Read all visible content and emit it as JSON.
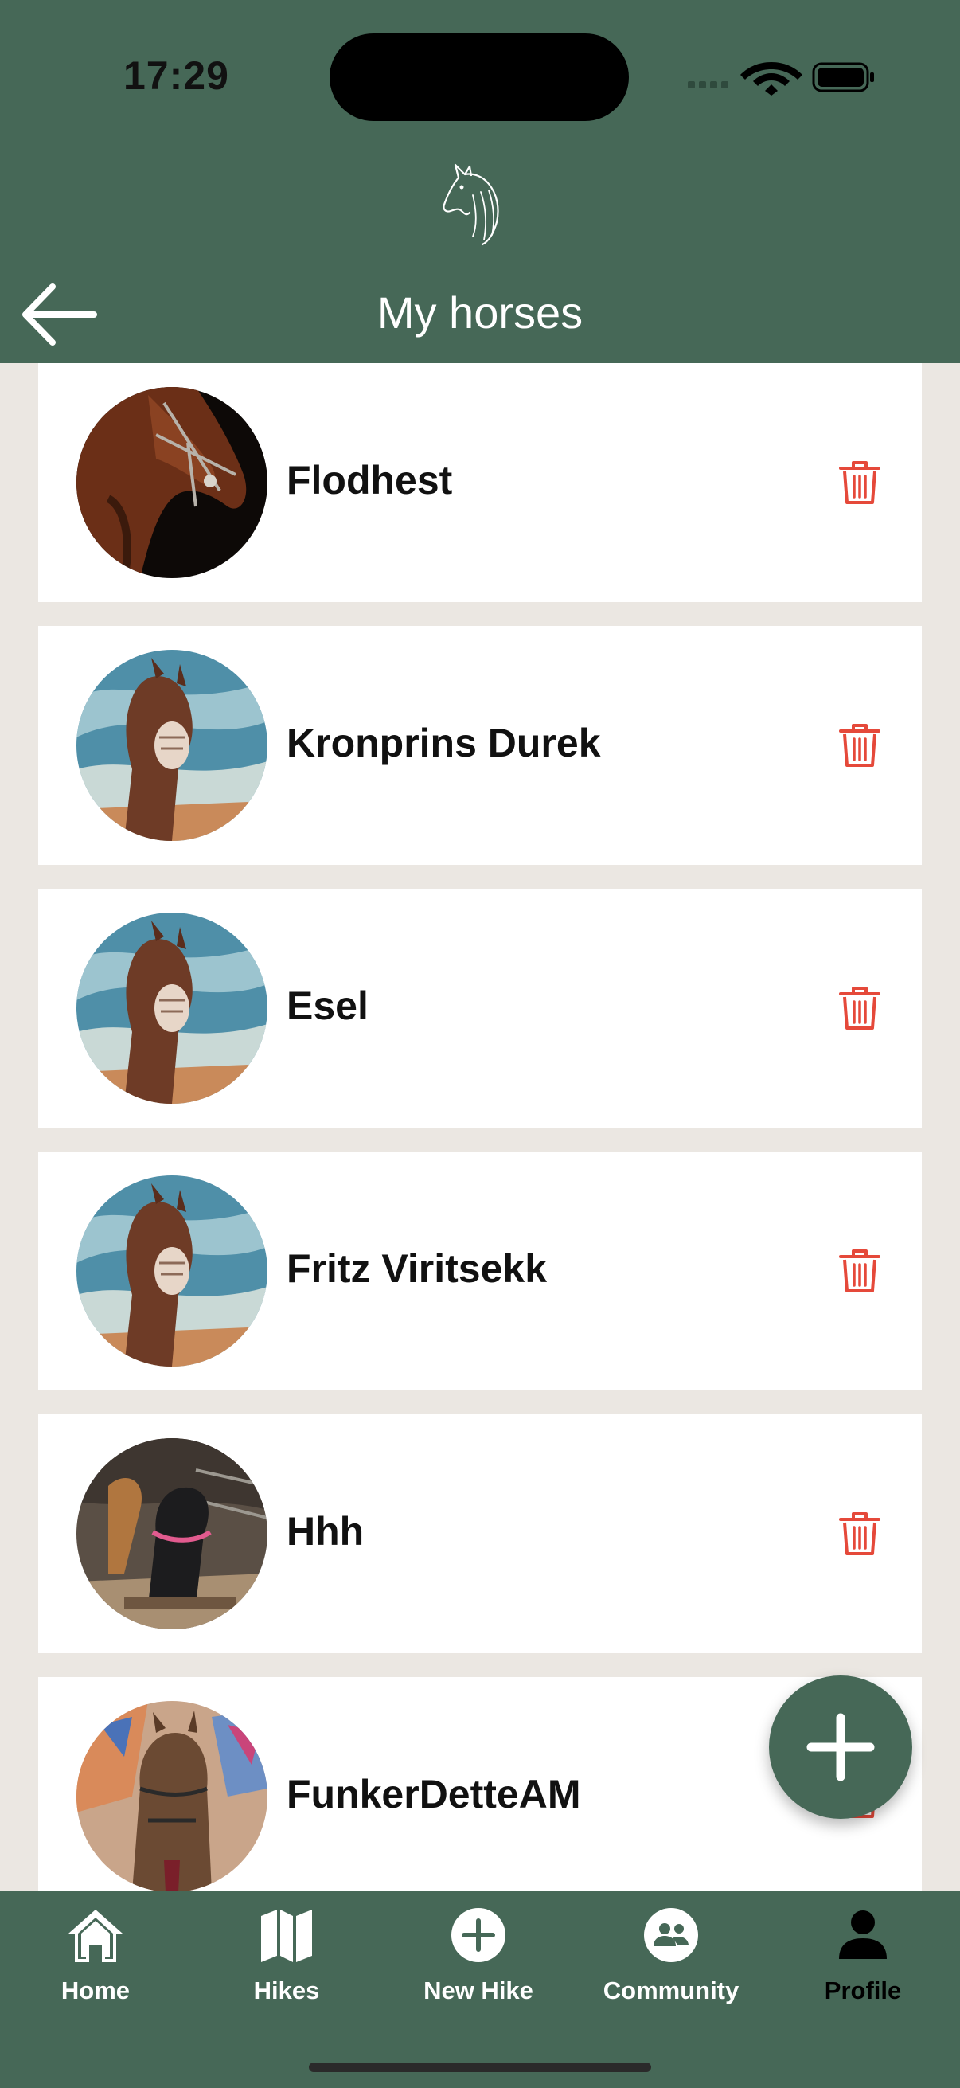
{
  "status_bar": {
    "time": "17:29"
  },
  "header": {
    "title": "My horses"
  },
  "horses": [
    {
      "name": "Flodhest",
      "photo": "dark-brown-horse-portrait"
    },
    {
      "name": "Kronprins Durek",
      "photo": "laughing-horse-blue-sky"
    },
    {
      "name": "Esel",
      "photo": "laughing-horse-blue-sky"
    },
    {
      "name": "Fritz Viritsekk",
      "photo": "laughing-horse-blue-sky"
    },
    {
      "name": "Hhh",
      "photo": "black-pony-outdoors"
    },
    {
      "name": "FunkerDetteAM",
      "photo": "bay-horse-bridle"
    }
  ],
  "tabs": [
    {
      "label": "Home",
      "icon": "home-icon"
    },
    {
      "label": "Hikes",
      "icon": "map-icon"
    },
    {
      "label": "New Hike",
      "icon": "plus-circle-icon"
    },
    {
      "label": "Community",
      "icon": "community-icon"
    },
    {
      "label": "Profile",
      "icon": "person-icon",
      "active": true
    }
  ],
  "colors": {
    "primary": "#466857",
    "background": "#ebe7e2",
    "delete": "#e5493a",
    "active_tab": "#000000"
  }
}
